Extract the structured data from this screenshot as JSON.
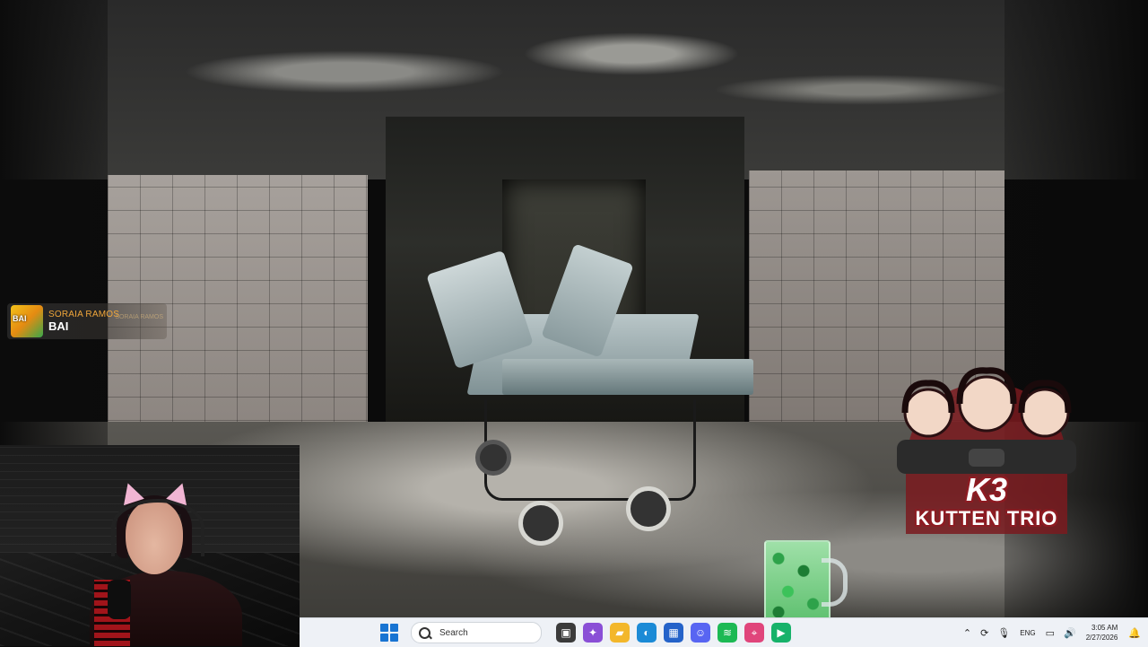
{
  "chat_alert": {
    "username": "SORAIA RAMOS",
    "message": "BAI",
    "ghost_username": "SORAIA RAMOS",
    "avatar_text": "BAI"
  },
  "logo": {
    "badge": "K3",
    "name": "KUTTEN TRIO"
  },
  "taskbar": {
    "search_placeholder": "Search",
    "apps": [
      {
        "name": "task-view",
        "icon": "task-view-icon",
        "color": "#3b3b3b"
      },
      {
        "name": "copilot",
        "icon": "copilot-icon",
        "color": "#8a4fd6"
      },
      {
        "name": "file-explorer",
        "icon": "folder-icon",
        "color": "#f3b72b"
      },
      {
        "name": "edge",
        "icon": "edge-icon",
        "color": "#1b8ad6"
      },
      {
        "name": "microsoft-store",
        "icon": "store-icon",
        "color": "#2563c9"
      },
      {
        "name": "discord",
        "icon": "discord-icon",
        "color": "#5865f2"
      },
      {
        "name": "spotify",
        "icon": "spotify-icon",
        "color": "#1db954"
      },
      {
        "name": "location-app",
        "icon": "pin-icon",
        "color": "#e0457b"
      },
      {
        "name": "streaming-app",
        "icon": "stream-app-icon",
        "color": "#17b26a"
      }
    ],
    "tray": {
      "language": "ENG",
      "time": "3:05 AM",
      "date": "2/27/2026"
    }
  },
  "colors": {
    "accent_taskbar": "#eef1f6",
    "start_blue": "#1874d2",
    "chat_username": "#f0a63a",
    "logo_red": "#8e1b22"
  }
}
